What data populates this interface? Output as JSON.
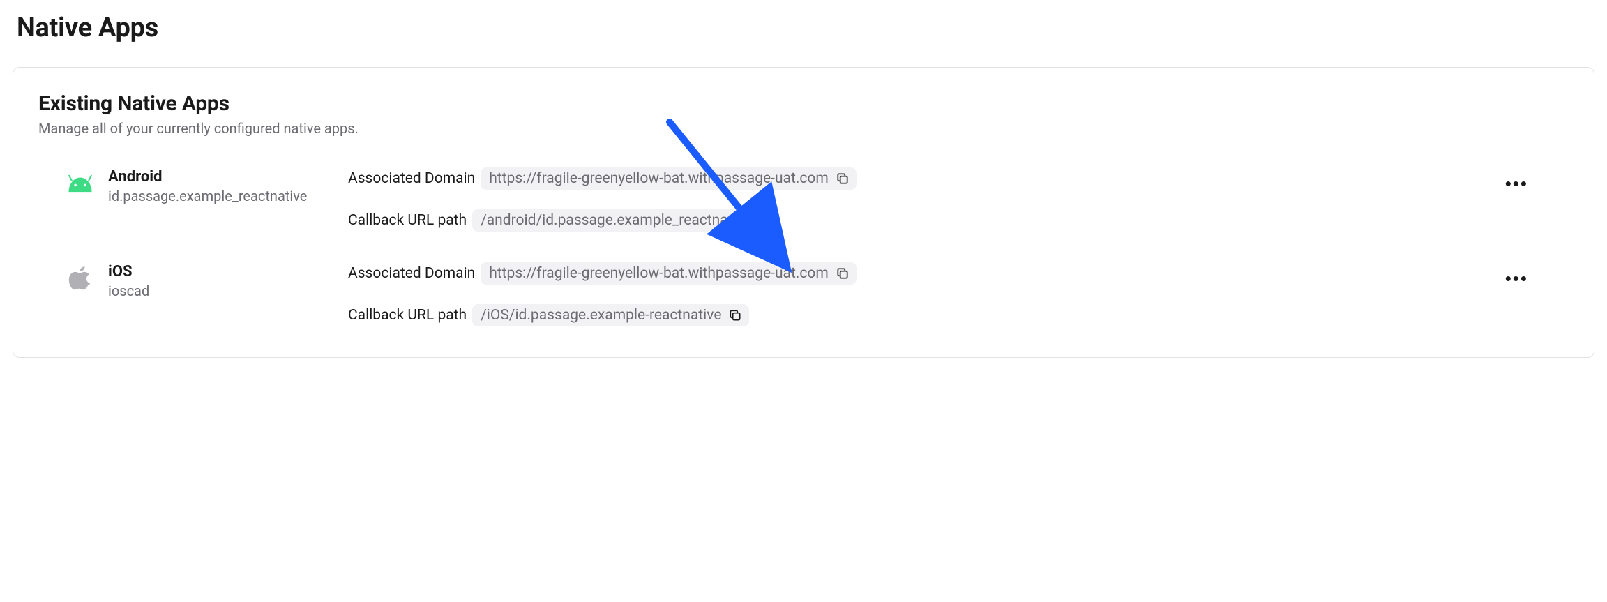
{
  "page": {
    "title": "Native Apps"
  },
  "card": {
    "title": "Existing Native Apps",
    "subtitle": "Manage all of your currently configured native apps."
  },
  "labels": {
    "associated_domain": "Associated Domain",
    "callback_path": "Callback URL path"
  },
  "apps": [
    {
      "platform": "Android",
      "id": "id.passage.example_reactnative",
      "domain": "https://fragile-greenyellow-bat.withpassage-uat.com",
      "callback": "/android/id.passage.example_reactnative"
    },
    {
      "platform": "iOS",
      "id": "ioscad",
      "domain": "https://fragile-greenyellow-bat.withpassage-uat.com",
      "callback": "/iOS/id.passage.example-reactnative"
    }
  ]
}
